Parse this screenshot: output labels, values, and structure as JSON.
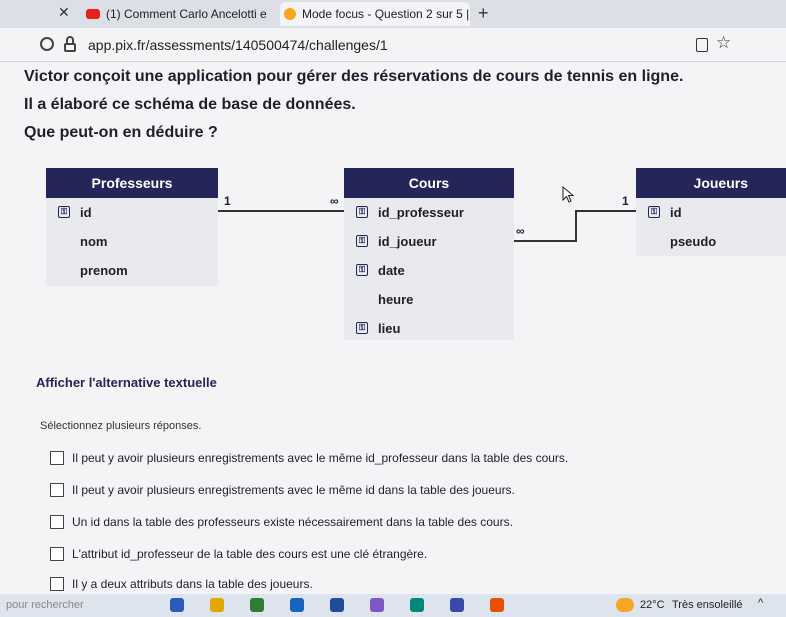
{
  "browser": {
    "tabs": [
      {
        "label": "(1) Comment Carlo Ancelotti es",
        "close": "✕"
      },
      {
        "label": "Mode focus - Question 2 sur 5 |",
        "close": "✕"
      }
    ],
    "new_tab": "+",
    "close_prev": "✕",
    "url": "app.pix.fr/assessments/140500474/challenges/1"
  },
  "question": {
    "line1": "Victor conçoit une application pour gérer des réservations de cours de tennis en ligne.",
    "line2": "Il a élaboré ce schéma de base de données.",
    "line3": "Que peut-on en déduire ?"
  },
  "schema": {
    "professeurs": {
      "title": "Professeurs",
      "fields": [
        "id",
        "nom",
        "prenom"
      ]
    },
    "cours": {
      "title": "Cours",
      "fields": [
        "id_professeur",
        "id_joueur",
        "date",
        "heure",
        "lieu"
      ]
    },
    "joueurs": {
      "title": "Joueurs",
      "fields": [
        "id",
        "pseudo"
      ]
    },
    "relations": {
      "one_a": "1",
      "many_a": "∞",
      "many_b": "∞",
      "one_b": "1"
    }
  },
  "alt_text_link": "Afficher l'alternative textuelle",
  "instruction": "Sélectionnez plusieurs réponses.",
  "choices": [
    "Il peut y avoir plusieurs enregistrements avec le même id_professeur dans la table des cours.",
    "Il peut y avoir plusieurs enregistrements avec le même id dans la table des joueurs.",
    "Un id dans la table des professeurs existe nécessairement dans la table des cours.",
    "L'attribut id_professeur de la table des cours est une clé étrangère.",
    "Il y a deux attributs dans la table des joueurs."
  ],
  "taskbar": {
    "search_hint": "pour rechercher",
    "temperature": "22°C",
    "weather": "Très ensoleillé",
    "chevron": "^"
  },
  "colors": {
    "table_header": "#24265a",
    "table_body": "#e9eaee"
  }
}
